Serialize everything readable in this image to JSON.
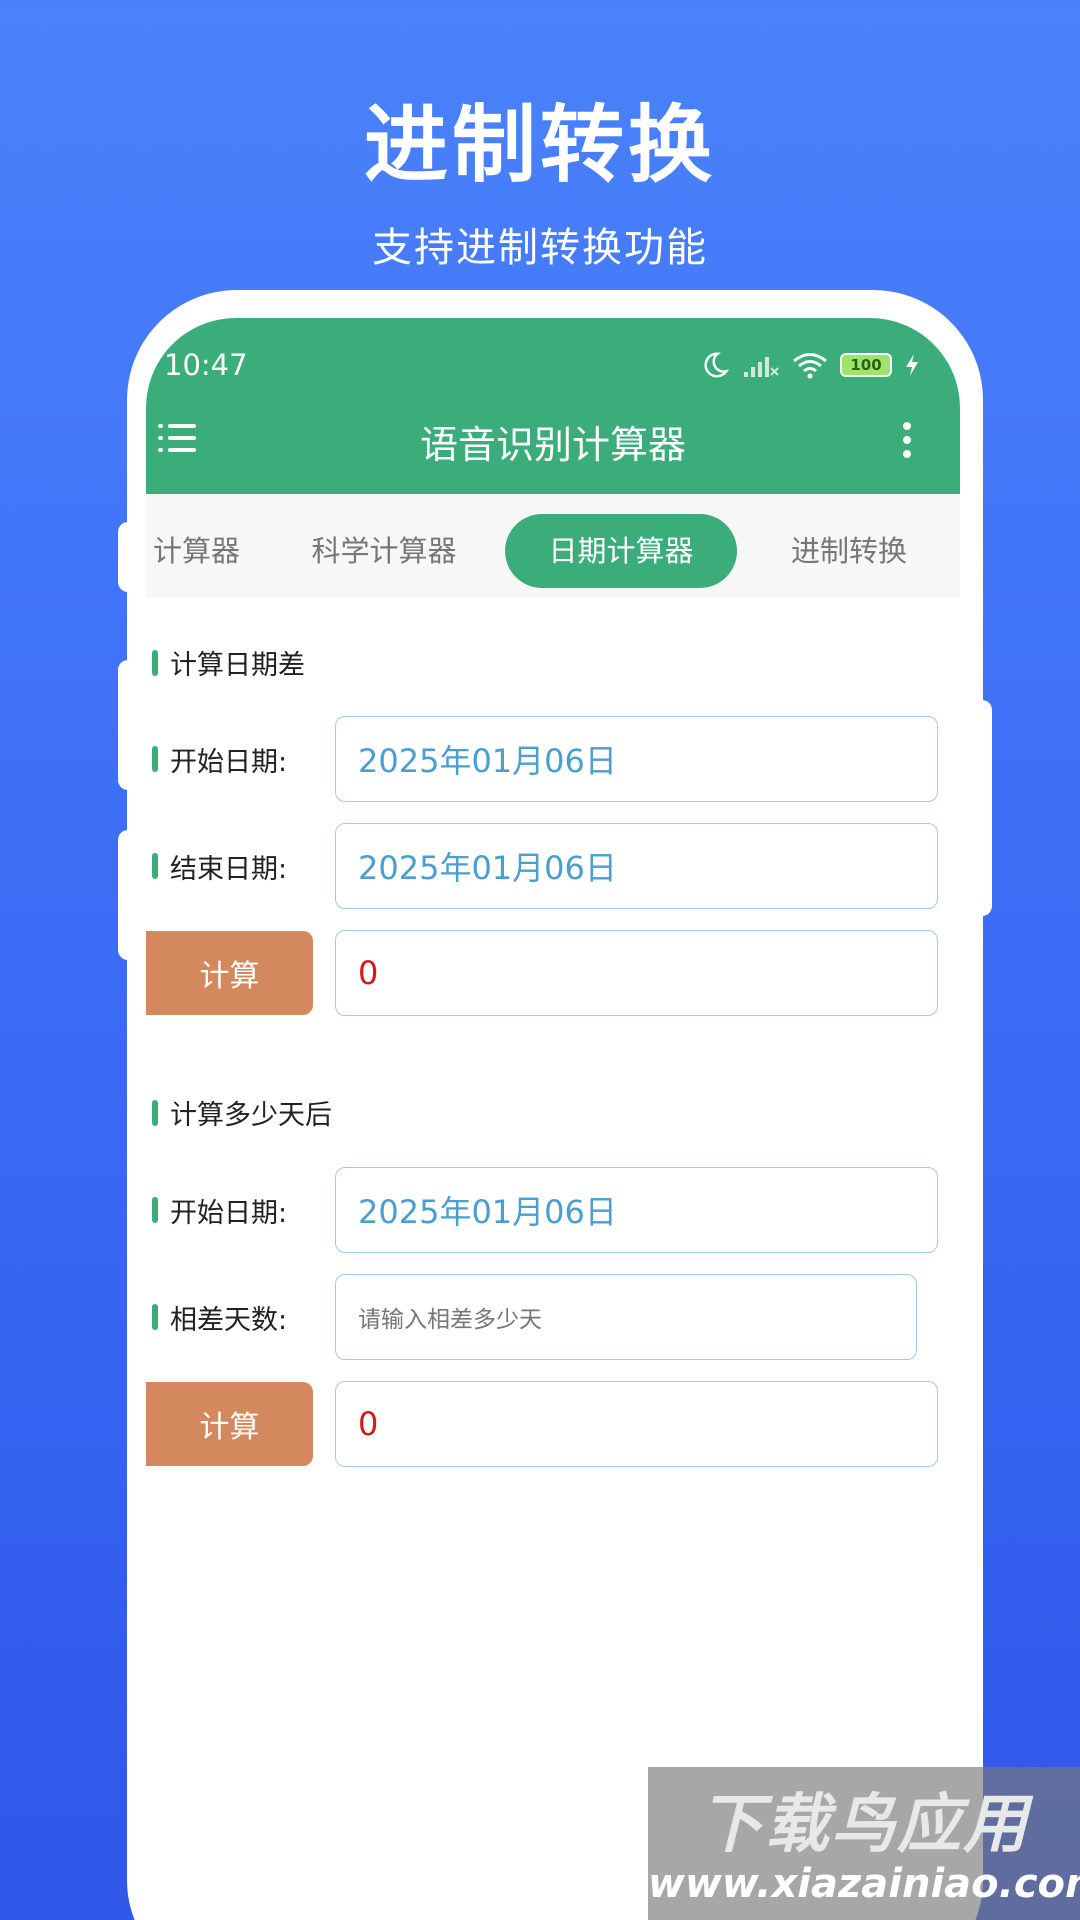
{
  "promo": {
    "title": "进制转换",
    "subtitle": "支持进制转换功能"
  },
  "status_bar": {
    "time": "10:47",
    "battery": "100",
    "icons": [
      "moon-icon",
      "signal-icon",
      "wifi-icon",
      "battery-icon",
      "charging-icon"
    ]
  },
  "toolbar": {
    "title": "语音识别计算器",
    "menu_icon": "menu-icon",
    "more_icon": "more-vert-icon"
  },
  "tabs": [
    {
      "label": "计算器",
      "active": false
    },
    {
      "label": "科学计算器",
      "active": false
    },
    {
      "label": "日期计算器",
      "active": true
    },
    {
      "label": "进制转换",
      "active": false
    }
  ],
  "date_diff": {
    "section_title": "计算日期差",
    "start_label": "开始日期:",
    "start_value": "2025年01月06日",
    "end_label": "结束日期:",
    "end_value": "2025年01月06日",
    "button": "计算",
    "result": "0"
  },
  "days_after": {
    "section_title": "计算多少天后",
    "start_label": "开始日期:",
    "start_value": "2025年01月06日",
    "days_label": "相差天数:",
    "days_placeholder": "请输入相差多少天",
    "button": "计算",
    "result": "0"
  },
  "watermark": {
    "line1": "下载鸟应用",
    "line2": "www.xiazainiao.com"
  },
  "colors": {
    "background": "#4a82fb",
    "accent_green": "#3aad7b",
    "button_orange": "#d4885e",
    "date_text_blue": "#4a9fd0",
    "result_red": "#d11b1b"
  }
}
